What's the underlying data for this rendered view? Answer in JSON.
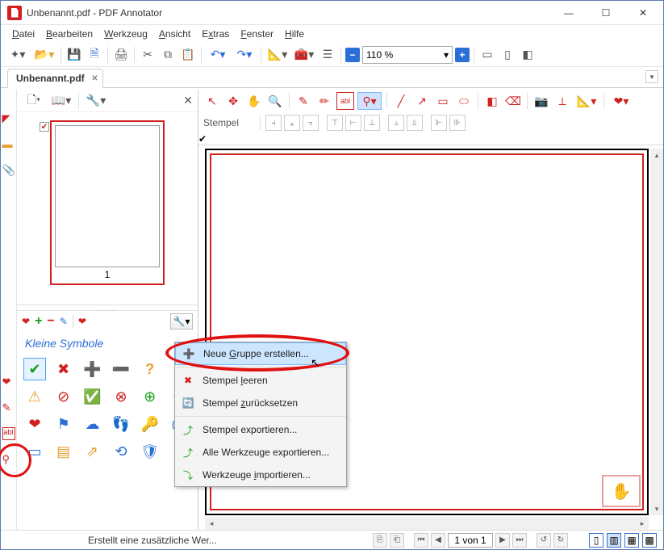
{
  "title": "Unbenannt.pdf - PDF Annotator",
  "menus": {
    "datei": "Datei",
    "bearbeiten": "Bearbeiten",
    "werkzeug": "Werkzeug",
    "ansicht": "Ansicht",
    "extras": "Extras",
    "fenster": "Fenster",
    "hilfe": "Hilfe"
  },
  "zoom": {
    "value": "110 %"
  },
  "doc_tab": "Unbenannt.pdf",
  "thumb": {
    "page_number": "1"
  },
  "split_dots": ".....",
  "symbols_title": "Kleine Symbole",
  "stamp_label": "Stempel",
  "context": {
    "new_group": "Neue Gruppe erstellen...",
    "empty": "Stempel leeren",
    "reset": "Stempel zurücksetzen",
    "export_stamps": "Stempel exportieren...",
    "export_tools": "Alle Werkzeuge exportieren...",
    "import_tools": "Werkzeuge importieren..."
  },
  "status": {
    "hint": "Erstellt eine zusätzliche Wer...",
    "page": "1 von 1"
  }
}
